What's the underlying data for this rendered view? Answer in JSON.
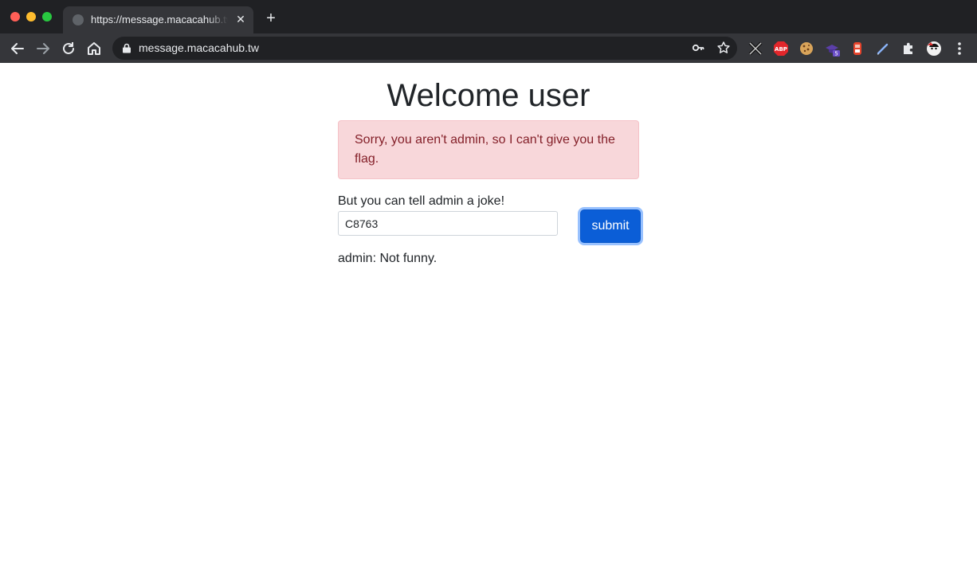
{
  "browser": {
    "tab_title": "https://message.macacahub.tw",
    "url": "message.macacahub.tw",
    "extension_badge": "5"
  },
  "page": {
    "heading": "Welcome user",
    "alert_text": "Sorry, you aren't admin, so I can't give you the flag.",
    "joke_label": "But you can tell admin a joke!",
    "joke_input_value": "C8763",
    "submit_label": "submit",
    "reply": "admin: Not funny."
  },
  "colors": {
    "alert_bg": "#f8d7da",
    "alert_text": "#842029",
    "submit_bg": "#0b5ed7"
  }
}
